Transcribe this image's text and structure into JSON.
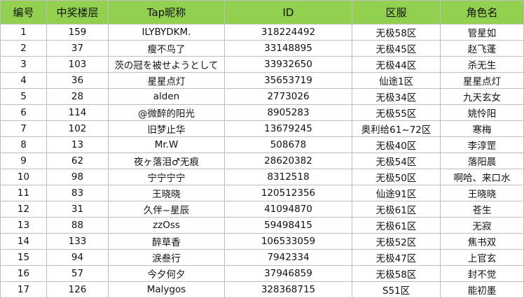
{
  "table": {
    "headers": [
      "编号",
      "中奖楼层",
      "Tap昵称",
      "ID",
      "区服",
      "角色名"
    ],
    "rows": [
      [
        "1",
        "159",
        "ILYBYDKM.",
        "318224492",
        "无极58区",
        "管星如"
      ],
      [
        "2",
        "37",
        "瘦不鸟了",
        "33148895",
        "无极45区",
        "赵飞蓬"
      ],
      [
        "3",
        "103",
        "茨の冠を被せようとして",
        "33932650",
        "无极44区",
        "杀无生"
      ],
      [
        "4",
        "36",
        "星星点灯",
        "35653719",
        "仙途1区",
        "星星点灯"
      ],
      [
        "5",
        "28",
        "alden",
        "2773026",
        "无极34区",
        "九天玄女"
      ],
      [
        "6",
        "114",
        "@微醉的阳光",
        "8905283",
        "无极55区",
        "姚怜阳"
      ],
      [
        "7",
        "102",
        "旧梦止华",
        "13679245",
        "奥利给61~72区",
        "寒梅"
      ],
      [
        "8",
        "13",
        "Mr.W",
        "508678",
        "无极40区",
        "李淳罡"
      ],
      [
        "9",
        "62",
        "夜ヶ落泪♂无痕",
        "28620382",
        "无极54区",
        "落阳晨"
      ],
      [
        "10",
        "98",
        "宁宁宁宁",
        "8312518",
        "无极50区",
        "啊哈、来口水"
      ],
      [
        "11",
        "83",
        "王晓晓",
        "120512356",
        "仙途91区",
        "王晓晓"
      ],
      [
        "12",
        "31",
        "久伴~星辰",
        "41094870",
        "无极61区",
        "苍生"
      ],
      [
        "13",
        "88",
        "zzOss",
        "59498415",
        "无极61区",
        "无寂"
      ],
      [
        "14",
        "133",
        "醉草香",
        "106533059",
        "无极52区",
        "焦书双"
      ],
      [
        "15",
        "94",
        "涙叁行",
        "7942334",
        "无极47区",
        "上官玄"
      ],
      [
        "16",
        "57",
        "今夕何夕",
        "37946859",
        "无极58区",
        "封不觉"
      ],
      [
        "17",
        "126",
        "Malygos",
        "328368715",
        "S51区",
        "能初墨"
      ]
    ]
  },
  "colors": {
    "header_background": "#92d050",
    "grid_line": "#bfbfbf"
  }
}
